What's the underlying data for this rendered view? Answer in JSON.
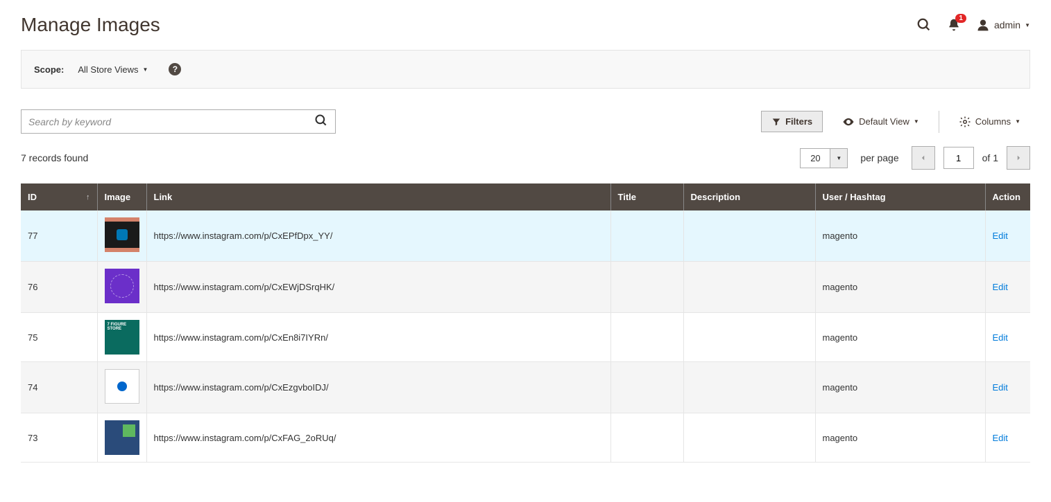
{
  "header": {
    "title": "Manage Images",
    "notif_count": "1",
    "user_label": "admin"
  },
  "scope": {
    "label": "Scope:",
    "value": "All Store Views"
  },
  "search": {
    "placeholder": "Search by keyword"
  },
  "toolbar": {
    "filters": "Filters",
    "default_view": "Default View",
    "columns": "Columns"
  },
  "grid": {
    "records_found": "7 records found",
    "per_page_value": "20",
    "per_page_label": "per page",
    "page_current": "1",
    "of_label": "of",
    "page_total": "1"
  },
  "columns": {
    "id": "ID",
    "image": "Image",
    "link": "Link",
    "title": "Title",
    "description": "Description",
    "user_hashtag": "User / Hashtag",
    "action": "Action"
  },
  "rows": [
    {
      "id": "77",
      "link": "https://www.instagram.com/p/CxEPfDpx_YY/",
      "title": "",
      "description": "",
      "user": "magento",
      "action": "Edit"
    },
    {
      "id": "76",
      "link": "https://www.instagram.com/p/CxEWjDSrqHK/",
      "title": "",
      "description": "",
      "user": "magento",
      "action": "Edit"
    },
    {
      "id": "75",
      "link": "https://www.instagram.com/p/CxEn8i7IYRn/",
      "title": "",
      "description": "",
      "user": "magento",
      "action": "Edit"
    },
    {
      "id": "74",
      "link": "https://www.instagram.com/p/CxEzgvboIDJ/",
      "title": "",
      "description": "",
      "user": "magento",
      "action": "Edit"
    },
    {
      "id": "73",
      "link": "https://www.instagram.com/p/CxFAG_2oRUq/",
      "title": "",
      "description": "",
      "user": "magento",
      "action": "Edit"
    }
  ],
  "thumb3_text": "7 FIGURE STORE"
}
